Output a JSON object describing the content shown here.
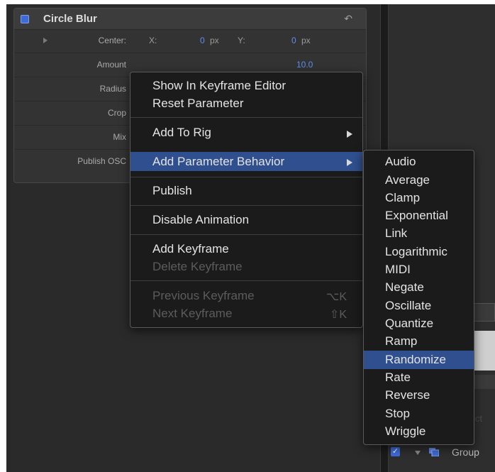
{
  "inspector": {
    "title": "Circle Blur",
    "reset_symbol": "↶",
    "rows": {
      "center": {
        "label": "Center:",
        "x_label": "X:",
        "x_value": "0",
        "x_unit": "px",
        "y_label": "Y:",
        "y_value": "0",
        "y_unit": "px"
      },
      "amount": {
        "label": "Amount",
        "value": "10.0"
      },
      "radius": {
        "label": "Radius"
      },
      "crop": {
        "label": "Crop"
      },
      "mix": {
        "label": "Mix"
      },
      "publish_osc": {
        "label": "Publish OSC"
      }
    }
  },
  "context_menu": {
    "items": {
      "show_keyframe_editor": "Show In Keyframe Editor",
      "reset_parameter": "Reset Parameter",
      "add_to_rig": "Add To Rig",
      "add_parameter_behavior": "Add Parameter Behavior",
      "publish": "Publish",
      "disable_animation": "Disable Animation",
      "add_keyframe": "Add Keyframe",
      "delete_keyframe": "Delete Keyframe",
      "previous_keyframe": "Previous Keyframe",
      "previous_keyframe_shortcut": "⌥K",
      "next_keyframe": "Next Keyframe",
      "next_keyframe_shortcut": "⇧K"
    },
    "highlighted": "Add Parameter Behavior"
  },
  "behavior_submenu": {
    "items": [
      "Audio",
      "Average",
      "Clamp",
      "Exponential",
      "Link",
      "Logarithmic",
      "MIDI",
      "Negate",
      "Oscillate",
      "Quantize",
      "Ramp",
      "Randomize",
      "Rate",
      "Reverse",
      "Stop",
      "Wriggle"
    ],
    "highlighted": "Randomize"
  },
  "layers": {
    "group_label": "Group",
    "check_symbol": "✓"
  },
  "right_pane": {
    "partial_text_ct": "ct",
    "partial_text_dr": "dr"
  },
  "colors": {
    "accent": "#3d6bd9",
    "menu_highlight": "#2f4f8f",
    "menu_bg": "#1b1b1b"
  }
}
